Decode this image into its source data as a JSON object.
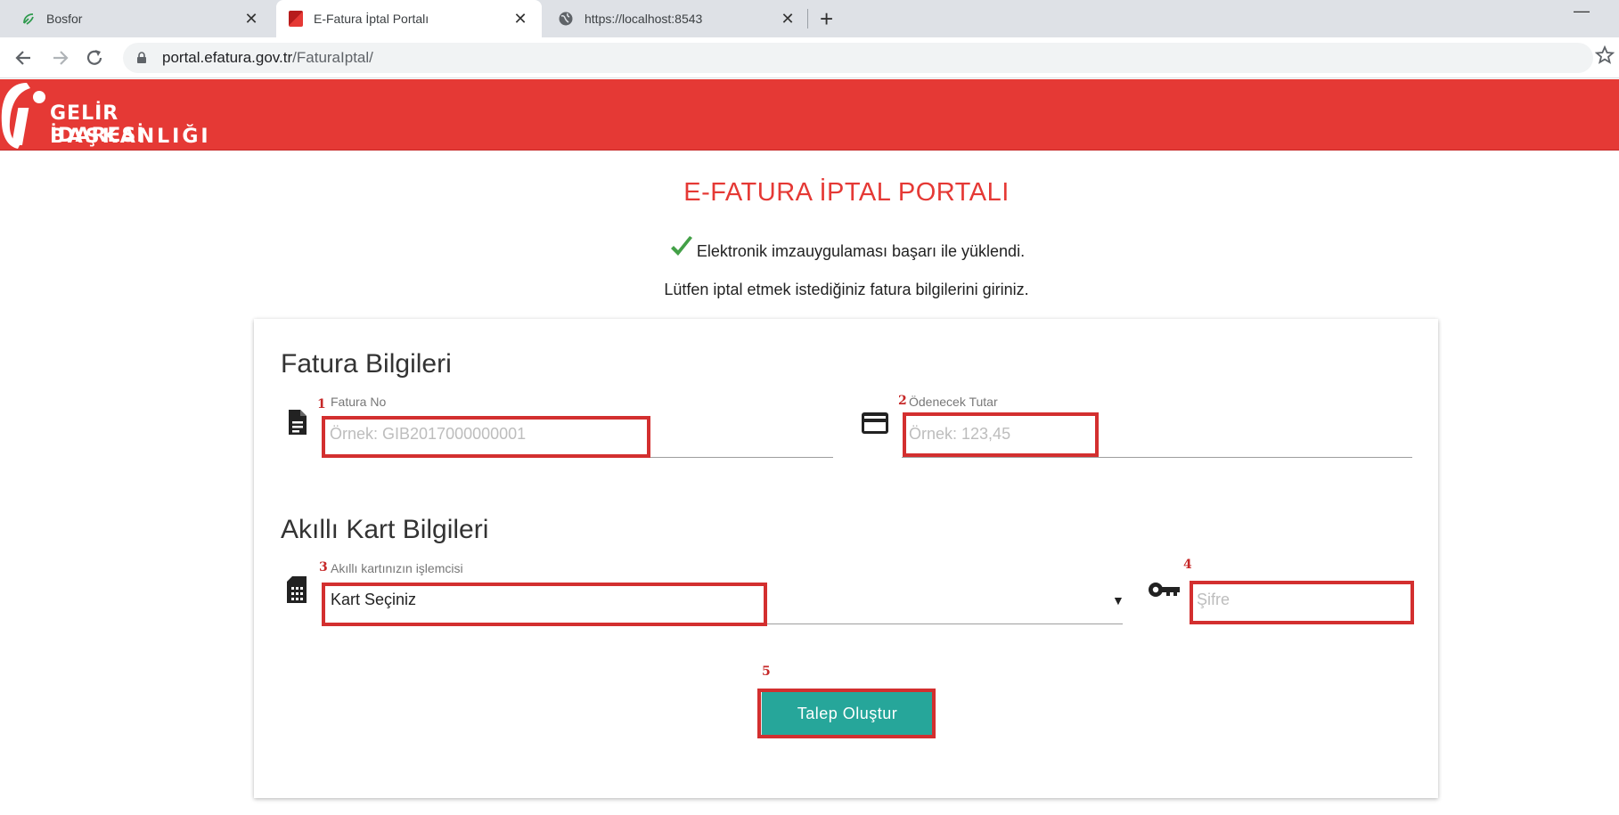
{
  "browser": {
    "tabs": [
      {
        "title": "Bosfor",
        "close": "✕"
      },
      {
        "title": "E-Fatura İptal Portalı",
        "close": "✕"
      },
      {
        "title": "https://localhost:8543",
        "close": "✕"
      }
    ],
    "new_tab": "+",
    "minimize": "—",
    "url_host": "portal.efatura.gov.tr",
    "url_path": "/FaturaIptal/"
  },
  "header": {
    "logo_line1": "GELİR İDARESİ",
    "logo_line2": "BAŞKANLIĞI"
  },
  "page": {
    "title": "E-FATURA İPTAL PORTALI",
    "success_message": "Elektronik imzauygulaması başarı ile yüklendi.",
    "instruction": "Lütfen iptal etmek istediğiniz fatura bilgilerini giriniz."
  },
  "fatura": {
    "section_title": "Fatura Bilgileri",
    "fatura_no_label": "Fatura No",
    "fatura_no_placeholder": "Örnek: GIB2017000000001",
    "tutar_label": "Ödenecek Tutar",
    "tutar_placeholder": "Örnek: 123,45"
  },
  "kart": {
    "section_title": "Akıllı Kart Bilgileri",
    "islemci_label": "Akıllı kartınızın işlemcisi",
    "islemci_selected": "Kart Seçiniz",
    "sifre_placeholder": "Şifre"
  },
  "actions": {
    "submit_label": "Talep Oluştur"
  },
  "annotations": {
    "m1": "1",
    "m2": "2",
    "m3": "3",
    "m4": "4",
    "m5": "5"
  },
  "colors": {
    "brand_red": "#e53935",
    "button_teal": "#26a69a",
    "highlight_red": "#d32f2f"
  }
}
